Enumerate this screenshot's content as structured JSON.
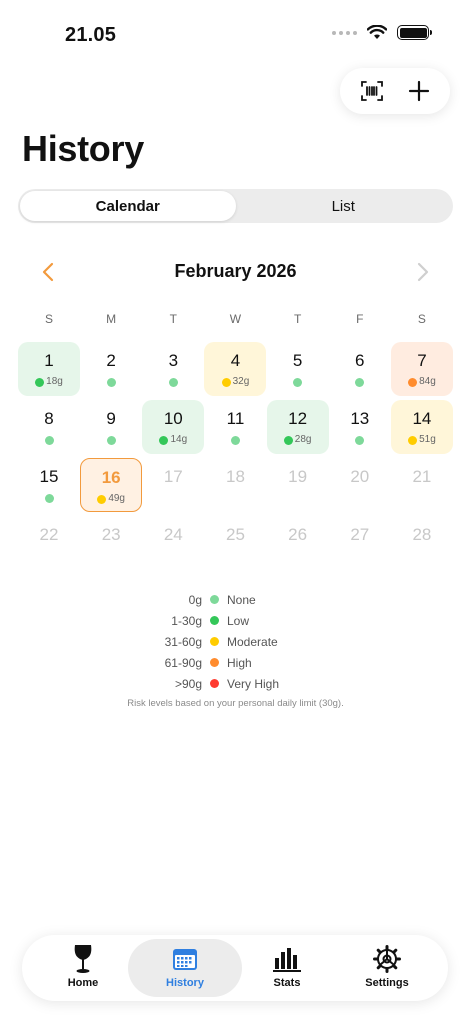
{
  "status_bar": {
    "time": "21.05"
  },
  "page": {
    "title": "History"
  },
  "segmented": {
    "calendar_label": "Calendar",
    "list_label": "List",
    "selected": "Calendar"
  },
  "calendar": {
    "month_label": "February 2026",
    "weekdays": [
      "S",
      "M",
      "T",
      "W",
      "T",
      "F",
      "S"
    ],
    "days": [
      {
        "day": "1",
        "amount": "18g",
        "level": "low"
      },
      {
        "day": "2",
        "amount": "",
        "level": "none"
      },
      {
        "day": "3",
        "amount": "",
        "level": "none"
      },
      {
        "day": "4",
        "amount": "32g",
        "level": "moderate"
      },
      {
        "day": "5",
        "amount": "",
        "level": "none"
      },
      {
        "day": "6",
        "amount": "",
        "level": "none"
      },
      {
        "day": "7",
        "amount": "84g",
        "level": "high"
      },
      {
        "day": "8",
        "amount": "",
        "level": "none"
      },
      {
        "day": "9",
        "amount": "",
        "level": "none"
      },
      {
        "day": "10",
        "amount": "14g",
        "level": "low"
      },
      {
        "day": "11",
        "amount": "",
        "level": "none"
      },
      {
        "day": "12",
        "amount": "28g",
        "level": "low"
      },
      {
        "day": "13",
        "amount": "",
        "level": "none"
      },
      {
        "day": "14",
        "amount": "51g",
        "level": "moderate"
      },
      {
        "day": "15",
        "amount": "",
        "level": "none"
      },
      {
        "day": "16",
        "amount": "49g",
        "level": "moderate",
        "today": true
      },
      {
        "day": "17",
        "future": true
      },
      {
        "day": "18",
        "future": true
      },
      {
        "day": "19",
        "future": true
      },
      {
        "day": "20",
        "future": true
      },
      {
        "day": "21",
        "future": true
      },
      {
        "day": "22",
        "future": true
      },
      {
        "day": "23",
        "future": true
      },
      {
        "day": "24",
        "future": true
      },
      {
        "day": "25",
        "future": true
      },
      {
        "day": "26",
        "future": true
      },
      {
        "day": "27",
        "future": true
      },
      {
        "day": "28",
        "future": true
      }
    ]
  },
  "levels": {
    "none": {
      "dot": "#7ed99a",
      "bg": "transparent"
    },
    "low": {
      "dot": "#34c759",
      "bg": "#e6f6ea"
    },
    "moderate": {
      "dot": "#ffcc00",
      "bg": "#fff6d9"
    },
    "high": {
      "dot": "#ff8c2e",
      "bg": "#ffece0"
    },
    "today_bg": "#fff1e3"
  },
  "legend": {
    "items": [
      {
        "range": "0g",
        "label": "None",
        "color": "#7ed99a"
      },
      {
        "range": "1-30g",
        "label": "Low",
        "color": "#34c759"
      },
      {
        "range": "31-60g",
        "label": "Moderate",
        "color": "#ffcc00"
      },
      {
        "range": "61-90g",
        "label": "High",
        "color": "#ff8c2e"
      },
      {
        "range": ">90g",
        "label": "Very High",
        "color": "#ff3b30"
      }
    ],
    "note": "Risk levels based on your personal daily limit (30g)."
  },
  "tabs": [
    {
      "label": "Home",
      "icon": "wine-glass-icon"
    },
    {
      "label": "History",
      "icon": "calendar-icon",
      "active": true
    },
    {
      "label": "Stats",
      "icon": "bar-chart-icon"
    },
    {
      "label": "Settings",
      "icon": "gear-icon"
    }
  ],
  "colors": {
    "accent": "#f29a3d",
    "tab_active": "#2f7fe0"
  }
}
